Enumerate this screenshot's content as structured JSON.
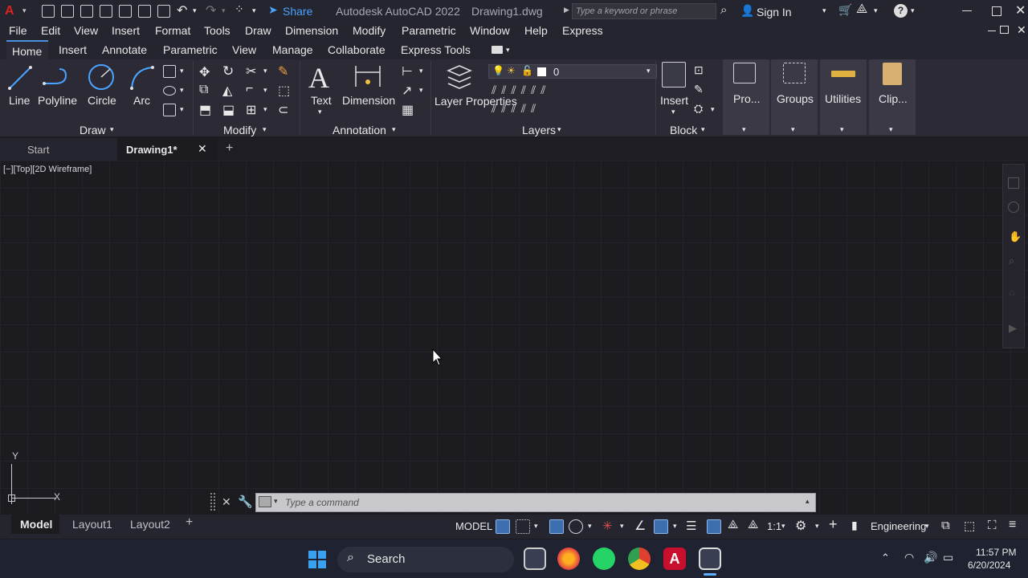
{
  "titlebar": {
    "share": "Share",
    "title": "Autodesk AutoCAD 2022",
    "file": "Drawing1.dwg",
    "search_placeholder": "Type a keyword or phrase",
    "sign_in": "Sign In"
  },
  "menu": [
    "File",
    "Edit",
    "View",
    "Insert",
    "Format",
    "Tools",
    "Draw",
    "Dimension",
    "Modify",
    "Parametric",
    "Window",
    "Help",
    "Express"
  ],
  "ribbon_tabs": [
    "Home",
    "Insert",
    "Annotate",
    "Parametric",
    "View",
    "Manage",
    "Collaborate",
    "Express Tools"
  ],
  "ribbon": {
    "draw": {
      "tools": [
        "Line",
        "Polyline",
        "Circle",
        "Arc"
      ],
      "panel": "Draw"
    },
    "modify": {
      "panel": "Modify"
    },
    "annotation": {
      "tools": [
        "Text",
        "Dimension"
      ],
      "panel": "Annotation"
    },
    "layers": {
      "tool": "Layer Properties",
      "current": "0",
      "panel": "Layers"
    },
    "block": {
      "tool": "Insert",
      "panel": "Block"
    },
    "extra": [
      "Pro...",
      "Groups",
      "Utilities",
      "Clip..."
    ]
  },
  "doctabs": {
    "start": "Start",
    "drawing": "Drawing1*"
  },
  "viewport": {
    "label": "[−][Top][2D Wireframe]"
  },
  "ucs": {
    "x": "X",
    "y": "Y"
  },
  "command": {
    "placeholder": "Type a command"
  },
  "layout_tabs": [
    "Model",
    "Layout1",
    "Layout2"
  ],
  "status": {
    "model": "MODEL",
    "scale": "1:1",
    "workspace": "Engineering"
  },
  "taskbar": {
    "search": "Search",
    "time": "11:57 PM",
    "date": "6/20/2024"
  }
}
